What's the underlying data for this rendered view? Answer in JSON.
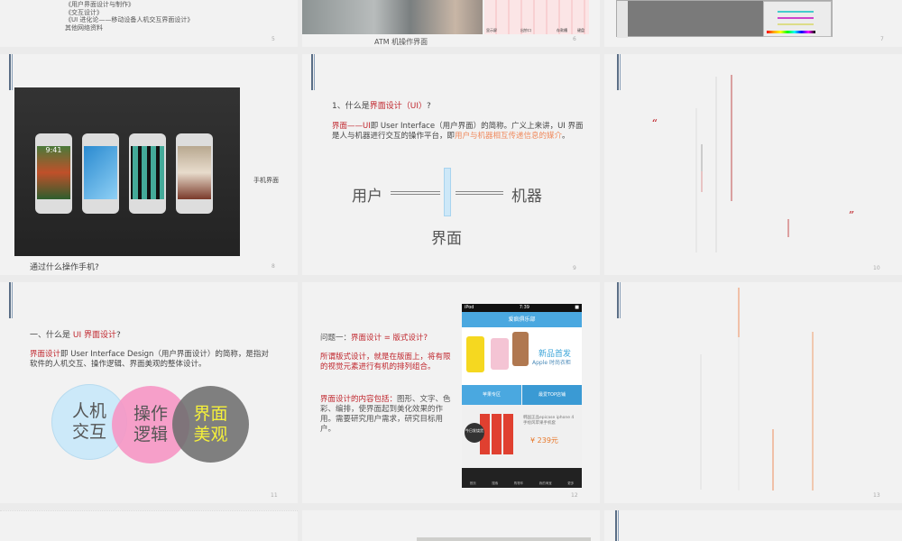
{
  "slides": [
    {
      "num": "5",
      "lines": [
        "《用户界面设计与制作》",
        "《交互设计》",
        "《UI 进化论——移动设备人机交互界面设计》",
        "其他网络资料"
      ]
    },
    {
      "num": "6",
      "caption": "ATM 机操作界面",
      "labels": [
        "显示屏",
        "出钞口",
        "存款槽",
        "键盘"
      ]
    },
    {
      "num": "7"
    },
    {
      "num": "8",
      "side": "手机界面",
      "caption": "通过什么操作手机?",
      "time": "9:41"
    },
    {
      "num": "9",
      "title_pre": "1、什么是",
      "title_red": "界面设计（UI）",
      "title_post": "?",
      "body_red": "界面——UI",
      "body_mid": "即 User Interface（用户界面）的简称。广义上来讲，UI 界面是人与机器进行交互的操作平台，即",
      "body_org": "用户与机器相互传递信息的媒介",
      "body_end": "。",
      "user": "用户",
      "machine": "机器",
      "interface": "界面"
    },
    {
      "num": "10",
      "q_open": "“",
      "q_close": "”"
    },
    {
      "num": "11",
      "title_pre": "一、什么是 ",
      "title_red": "UI 界面设计",
      "title_post": "?",
      "body_red": "界面设计",
      "body_rest": "即 User Interface Design（用户界面设计）的简称，是指对软件的人机交互、操作逻辑、界面美观的整体设计。",
      "c1": "人机交互",
      "c2": "操作逻辑",
      "c3": "界面美观"
    },
    {
      "num": "12",
      "q_pre": "问题一：",
      "q_red": "界面设计 = 版式设计?",
      "p1": "所谓版式设计，就是在版面上，将有限的视觉元素进行有机的排列组合。",
      "p2_red": "界面设计的内容包括：",
      "p2_rest": "图形、文字、色彩、编排，使界面起到美化效果的作用。需要研究用户需求，研究目标用户。",
      "phone": {
        "carrier": "iPod",
        "time": "7:39",
        "app": "爱疯俱乐部",
        "banner1": "新品首发",
        "banner2": "Apple 时尚衣柜",
        "tab1": "苹果专区",
        "tab2": "最爱TOP店铺",
        "product": "韩国正品epicase iphone 4 手绘风苹果手机套",
        "price": "¥ 239元",
        "badge": "今日发烧货",
        "nav": [
          "首页",
          "搜索",
          "购物车",
          "我的淘宝",
          "更多"
        ]
      }
    },
    {
      "num": "13"
    }
  ]
}
